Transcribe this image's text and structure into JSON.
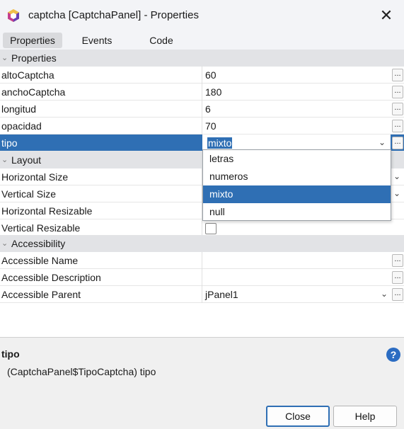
{
  "window": {
    "title": "captcha [CaptchaPanel] - Properties",
    "close_glyph": "✕"
  },
  "tabs": [
    {
      "label": "Properties",
      "active": true
    },
    {
      "label": "Events",
      "active": false
    },
    {
      "label": "Code",
      "active": false
    }
  ],
  "sections": {
    "properties": "Properties",
    "layout": "Layout",
    "accessibility": "Accessibility"
  },
  "properties": [
    {
      "name": "altoCaptcha",
      "value": "60"
    },
    {
      "name": "anchoCaptcha",
      "value": "180"
    },
    {
      "name": "longitud",
      "value": "6"
    },
    {
      "name": "opacidad",
      "value": "70"
    },
    {
      "name": "tipo",
      "value": "mixto"
    }
  ],
  "layout": [
    {
      "name": "Horizontal Size"
    },
    {
      "name": "Vertical Size"
    },
    {
      "name": "Horizontal Resizable"
    },
    {
      "name": "Vertical Resizable"
    }
  ],
  "accessibility": [
    {
      "name": "Accessible Name",
      "value": ""
    },
    {
      "name": "Accessible Description",
      "value": ""
    },
    {
      "name": "Accessible Parent",
      "value": "jPanel1"
    }
  ],
  "dropdown": {
    "options": [
      "letras",
      "numeros",
      "mixto",
      "null"
    ],
    "selected": "mixto"
  },
  "ellipsis_label": "...",
  "description": {
    "title": "tipo",
    "text": "(CaptchaPanel$TipoCaptcha) tipo",
    "help_glyph": "?"
  },
  "buttons": {
    "close": "Close",
    "help": "Help"
  },
  "colors": {
    "selection": "#2f6fb4",
    "section_bg": "#e2e3e6",
    "help_icon": "#2b6cc2"
  },
  "icons": {
    "app": "netbeans-cube-icon",
    "close": "close-icon",
    "help": "help-icon",
    "collapse": "chevron-down-icon"
  }
}
